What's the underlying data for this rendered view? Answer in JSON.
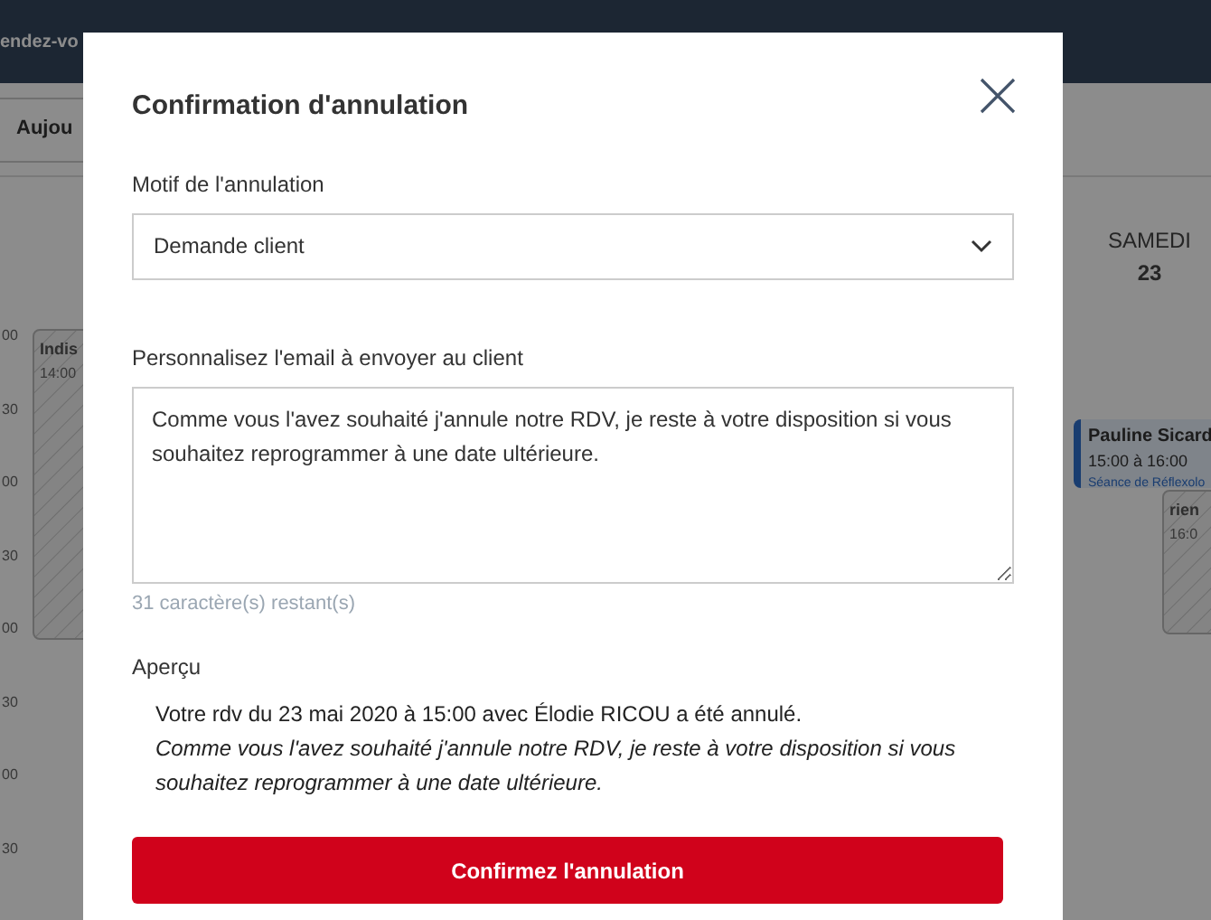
{
  "background": {
    "header_title": "endez-vo",
    "today_button": "Aujou",
    "time_labels": [
      "00",
      "30",
      "00",
      "30",
      "00",
      "30",
      "00",
      "30"
    ],
    "day_header": {
      "name": "SAMEDI",
      "number": "23"
    },
    "events": [
      {
        "kind": "unavailable",
        "title": "Indis",
        "time": "14:00"
      },
      {
        "kind": "appointment",
        "title": "Pauline Sicard",
        "time": "15:00 à 16:00",
        "service": "Séance de Réflexolo"
      },
      {
        "kind": "unavailable",
        "title": "rien",
        "time": "16:0"
      }
    ]
  },
  "modal": {
    "title": "Confirmation d'annulation",
    "reason": {
      "label": "Motif de l'annulation",
      "value": "Demande client"
    },
    "email": {
      "label": "Personnalisez l'email à envoyer au client",
      "value": "Comme vous l'avez souhaité j'annule notre RDV, je reste à votre disposition si vous souhaitez reprogrammer à une date ultérieure."
    },
    "counter": "31 caractère(s) restant(s)",
    "preview": {
      "label": "Aperçu",
      "line": "Votre rdv du 23 mai 2020 à 15:00 avec Élodie RICOU a été annulé.",
      "message": "Comme vous l'avez souhaité j'annule notre RDV, je reste à votre disposition si vous souhaitez reprogrammer à une date ultérieure."
    },
    "confirm_button": "Confirmez l'annulation"
  }
}
